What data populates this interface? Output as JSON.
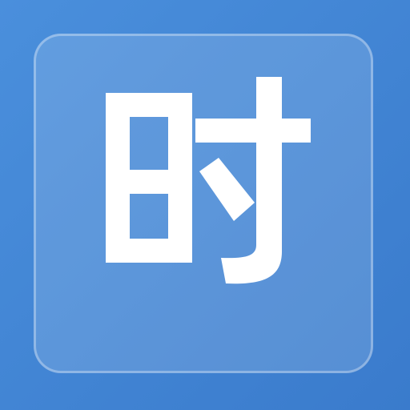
{
  "icon": {
    "character": "时",
    "background_color": "#4288d8",
    "tile_color": "#5e9ae0",
    "glyph_color": "#ffffff"
  }
}
